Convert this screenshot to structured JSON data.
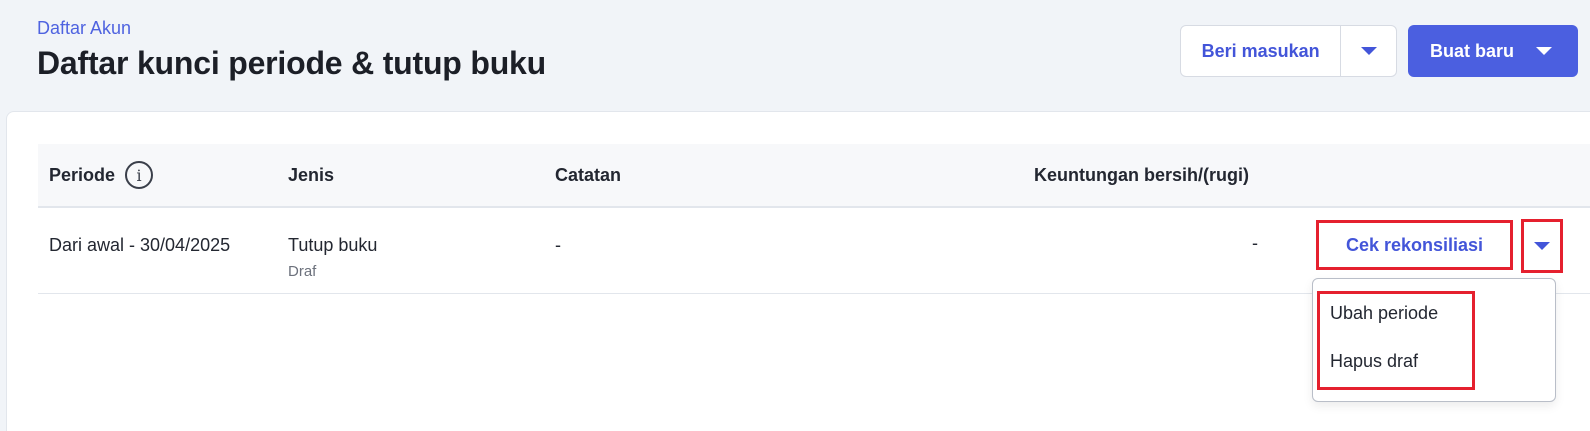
{
  "header": {
    "breadcrumb": "Daftar Akun",
    "title": "Daftar kunci periode & tutup buku",
    "feedback_label": "Beri masukan",
    "create_label": "Buat baru"
  },
  "table": {
    "columns": {
      "period": "Periode",
      "type": "Jenis",
      "note": "Catatan",
      "net_profit": "Keuntungan bersih/(rugi)"
    },
    "rows": [
      {
        "period": "Dari awal - 30/04/2025",
        "type": "Tutup buku",
        "status": "Draf",
        "note": "-",
        "net_profit": "-",
        "action_label": "Cek rekonsiliasi"
      }
    ]
  },
  "dropdown": {
    "items": [
      "Ubah periode",
      "Hapus draf"
    ]
  },
  "colors": {
    "accent": "#4b5fe0",
    "highlight": "#e5202e"
  },
  "icons": {
    "info": "info-icon",
    "caret": "chevron-down-icon"
  }
}
